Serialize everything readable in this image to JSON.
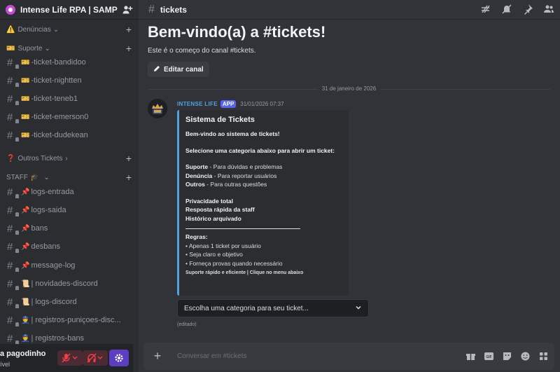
{
  "server": {
    "name": "Intense Life RPA | SAMP"
  },
  "sidebar": {
    "categories": [
      {
        "label": "Denúncias",
        "emoji": "⚠️"
      },
      {
        "label": "Suporte",
        "emoji": "🎫"
      },
      {
        "label": "Outros Tickets",
        "emoji": "❓"
      },
      {
        "label": "STAFF",
        "emoji": "🎓"
      }
    ],
    "channels": [
      {
        "emoji": "🎫",
        "label": "-ticket-bandidoo"
      },
      {
        "emoji": "🎫",
        "label": "-ticket-nightten"
      },
      {
        "emoji": "🎫",
        "label": "-ticket-teneb1"
      },
      {
        "emoji": "🎫",
        "label": "-ticket-emerson0"
      },
      {
        "emoji": "🎫",
        "label": "-ticket-dudekean"
      },
      {
        "emoji": "📌",
        "label": "logs-entrada"
      },
      {
        "emoji": "📌",
        "label": "logs-saida"
      },
      {
        "emoji": "📌",
        "label": "bans"
      },
      {
        "emoji": "📌",
        "label": "desbans"
      },
      {
        "emoji": "📌",
        "label": "message-log"
      },
      {
        "emoji": "📜",
        "label": "| novidades-discord"
      },
      {
        "emoji": "📜",
        "label": "| logs-discord"
      },
      {
        "emoji": "👮",
        "label": "| registros-puniçoes-disc..."
      },
      {
        "emoji": "👮",
        "label": "| registros-bans"
      }
    ]
  },
  "user": {
    "name": "a pagodinho",
    "status": "ível"
  },
  "channel": {
    "name": "tickets"
  },
  "welcome": {
    "title": "Bem-vindo(a) a #tickets!",
    "subtitle": "Este é o começo do canal #tickets.",
    "edit_label": "Editar canal"
  },
  "date_divider": "31 de janeiro de 2026",
  "message": {
    "author": "INTENSE LIFE",
    "badge": "APP",
    "timestamp": "31/01/2026 07:37",
    "embed": {
      "title": "Sistema de Tickets",
      "intro": "Bem-vindo ao sistema de tickets!",
      "instruction": "Selecione uma categoria abaixo para abrir um ticket:",
      "options": [
        {
          "name": "Suporte",
          "desc": " - Para dúvidas e problemas"
        },
        {
          "name": "Denúncia",
          "desc": " - Para reportar usuários"
        },
        {
          "name": "Outros",
          "desc": " - Para outras questões"
        }
      ],
      "features": [
        "Privacidade total",
        "Resposta rápida da staff",
        "Histórico arquivado"
      ],
      "rules_title": "Regras:",
      "rules": [
        "• Apenas 1 ticket por usuário",
        "• Seja claro e objetivo",
        "• Forneça provas quando necessário"
      ],
      "footer": "Suporte rápido e eficiente | Clique no menu abaixo"
    },
    "select_placeholder": "Escolha uma categoria para seu ticket...",
    "edited": "(editado)"
  },
  "composer": {
    "placeholder": "Conversar em #tickets"
  }
}
